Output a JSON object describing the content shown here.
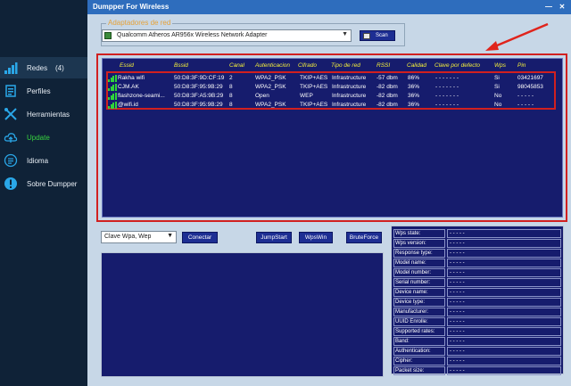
{
  "sidebar": {
    "items": [
      {
        "label": "Redes",
        "count": "(4)",
        "icon": "wifi-icon"
      },
      {
        "label": "Perfiles",
        "icon": "profiles-icon"
      },
      {
        "label": "Herramientas",
        "icon": "tools-icon"
      },
      {
        "label": "Update",
        "icon": "cloud-upload-icon"
      },
      {
        "label": "Idioma",
        "icon": "language-icon"
      },
      {
        "label": "Sobre Dumpper",
        "icon": "info-icon"
      }
    ]
  },
  "window": {
    "title": "Dumpper For Wireless"
  },
  "adapters": {
    "group_label": "Adaptadores de red",
    "selected": "Qualcomm Atheros AR956x Wireless Network Adapter",
    "scan_label": "Scan"
  },
  "networks": {
    "columns": [
      "Essid",
      "Bssid",
      "Canal",
      "Autenticacion",
      "Cifrado",
      "Tipo de red",
      "RSSI",
      "Calidad",
      "Clave por defecto",
      "Wps",
      "Pin"
    ],
    "rows": [
      {
        "essid": "Rakha wifi",
        "bssid": "50:D8:3F:9D:CF:19",
        "canal": "2",
        "auth": "WPA2_PSK",
        "cifrado": "TKIP+AES",
        "tipo": "Infrastructure",
        "rssi": "-57 dbm",
        "calidad": "86%",
        "clave": "- - - - - - -",
        "wps": "Si",
        "pin": "03421697"
      },
      {
        "essid": "CJM.AK",
        "bssid": "50:D8:3F:95:9B:29",
        "canal": "8",
        "auth": "WPA2_PSK",
        "cifrado": "TKIP+AES",
        "tipo": "Infrastructure",
        "rssi": "-82 dbm",
        "calidad": "36%",
        "clave": "- - - - - - -",
        "wps": "Si",
        "pin": "98045853"
      },
      {
        "essid": "flashzone-seami...",
        "bssid": "50:D8:3F:A5:9B:29",
        "canal": "8",
        "auth": "Open",
        "cifrado": "WEP",
        "tipo": "Infrastructure",
        "rssi": "-82 dbm",
        "calidad": "36%",
        "clave": "- - - - - - -",
        "wps": "No",
        "pin": "- - - - -"
      },
      {
        "essid": "@wifi.id",
        "bssid": "50:D8:3F:95:9B:29",
        "canal": "8",
        "auth": "WPA2_PSK",
        "cifrado": "TKIP+AES",
        "tipo": "Infrastructure",
        "rssi": "-82 dbm",
        "calidad": "36%",
        "clave": "- - - - - - -",
        "wps": "No",
        "pin": "- - - - -"
      }
    ]
  },
  "controls": {
    "mode_select": "Clave Wpa, Wep",
    "connect_label": "Conectar",
    "jumpstart_label": "JumpStart",
    "wpswin_label": "WpsWin",
    "bruteforce_label": "BruteForce"
  },
  "wps_info": {
    "rows": [
      {
        "label": "Wps state:",
        "value": "- - - - -"
      },
      {
        "label": "Wps version:",
        "value": "- - - - -"
      },
      {
        "label": "Response type:",
        "value": "- - - - -"
      },
      {
        "label": "Model name:",
        "value": "- - - - -"
      },
      {
        "label": "Model number:",
        "value": "- - - - -"
      },
      {
        "label": "Serial number:",
        "value": "- - - - -"
      },
      {
        "label": "Device name:",
        "value": "- - - - -"
      },
      {
        "label": "Device type:",
        "value": "- - - - -"
      },
      {
        "label": "Manufacturer:",
        "value": "- - - - -"
      },
      {
        "label": "UUID Enrolle:",
        "value": "- - - - -"
      },
      {
        "label": "Supported rates:",
        "value": "- - - - -"
      },
      {
        "label": "Band:",
        "value": "- - - - -"
      },
      {
        "label": "Authentication:",
        "value": "- - - - -"
      },
      {
        "label": "Cipher:",
        "value": "- - - - -"
      },
      {
        "label": "Packet size:",
        "value": "- - - - -"
      }
    ]
  },
  "colors": {
    "sidebar_bg": "#0f2237",
    "window_bg": "#c7d7e7",
    "titlebar": "#2e6dbd",
    "table_bg": "#161c6d",
    "header_text": "#f6f13a",
    "highlight_frame": "#d12020",
    "update_text": "#37d43f"
  }
}
